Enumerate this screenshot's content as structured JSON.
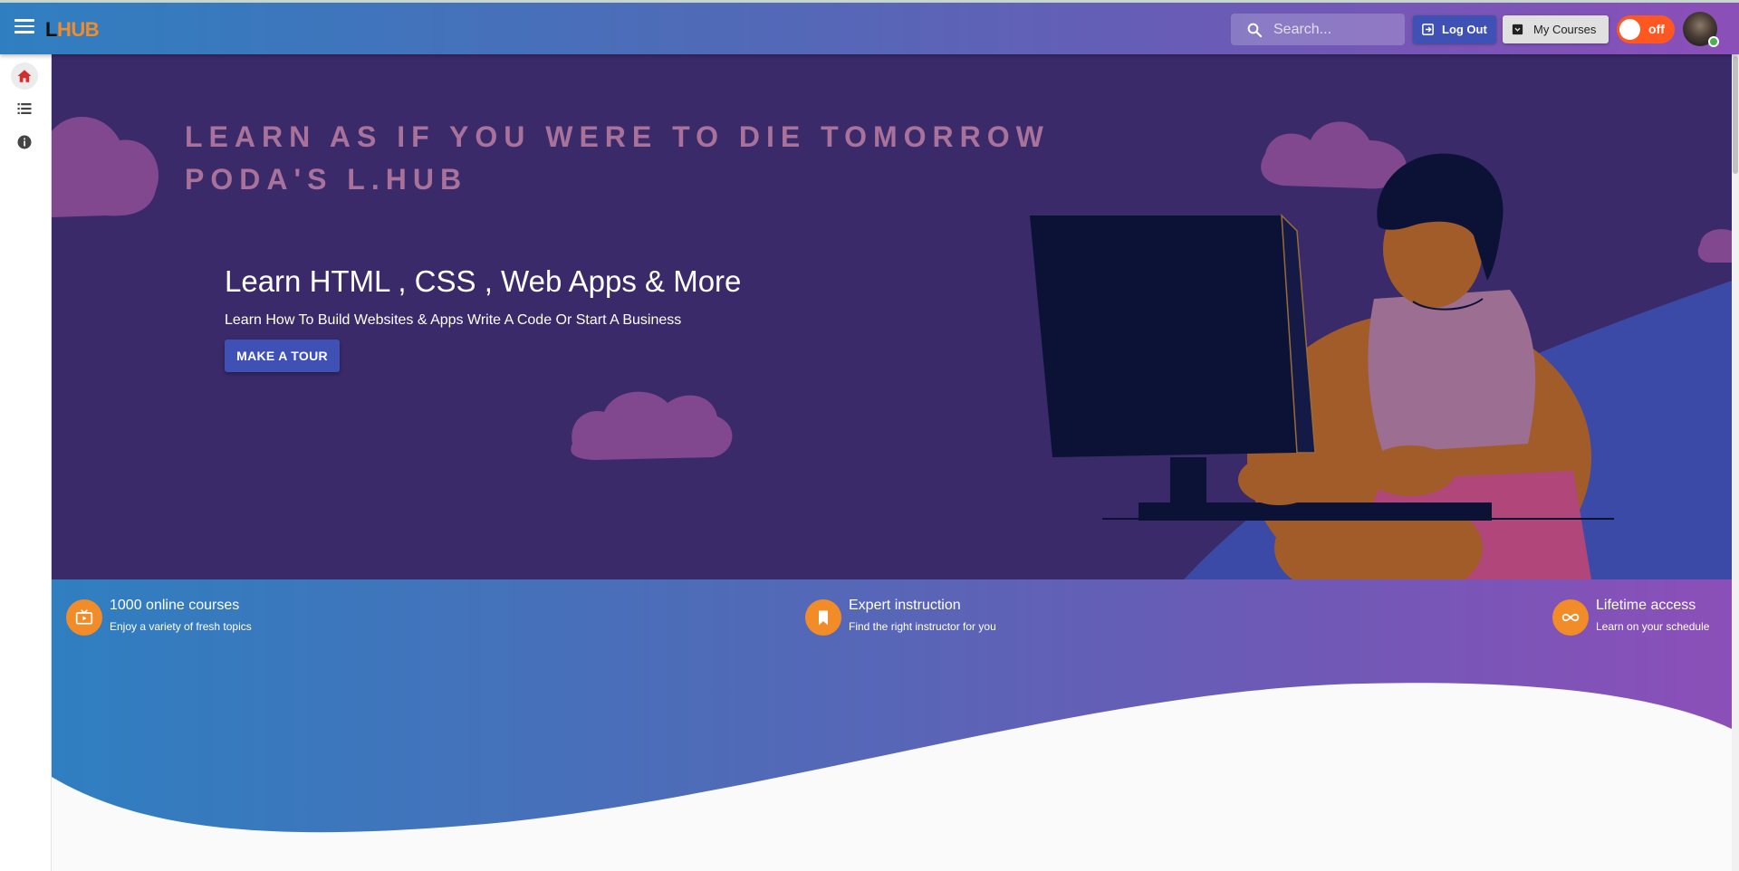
{
  "appbar": {
    "logo_l": "L",
    "logo_hub": "HUB",
    "search_placeholder": "Search...",
    "logout_label": "Log Out",
    "my_courses_label": "My Courses",
    "theme_toggle_label": "off"
  },
  "sidebar": {
    "items": [
      {
        "icon": "home-icon",
        "active": true
      },
      {
        "icon": "list-icon",
        "active": false
      },
      {
        "icon": "info-icon",
        "active": false
      }
    ]
  },
  "hero": {
    "quote_line1": "LEARN AS IF YOU WERE TO DIE TOMORROW",
    "quote_line2": "PODA'S L.HUB",
    "title": "Learn HTML , CSS , Web Apps & More",
    "subtitle": "Learn How To Build Websites & Apps Write A Code Or Start A Business",
    "tour_button": "MAKE A TOUR"
  },
  "features": [
    {
      "icon": "tv-icon",
      "title": "1000 online courses",
      "subtitle": "Enjoy a variety of fresh topics"
    },
    {
      "icon": "bookmark-icon",
      "title": "Expert instruction",
      "subtitle": "Find the right instructor for you"
    },
    {
      "icon": "infinity-icon",
      "title": "Lifetime access",
      "subtitle": "Learn on your schedule"
    }
  ],
  "colors": {
    "accent_orange": "#f28c28",
    "primary_indigo": "#3f51b5",
    "hero_bg": "#3a2a6a",
    "toggle_red": "#ff5722"
  }
}
